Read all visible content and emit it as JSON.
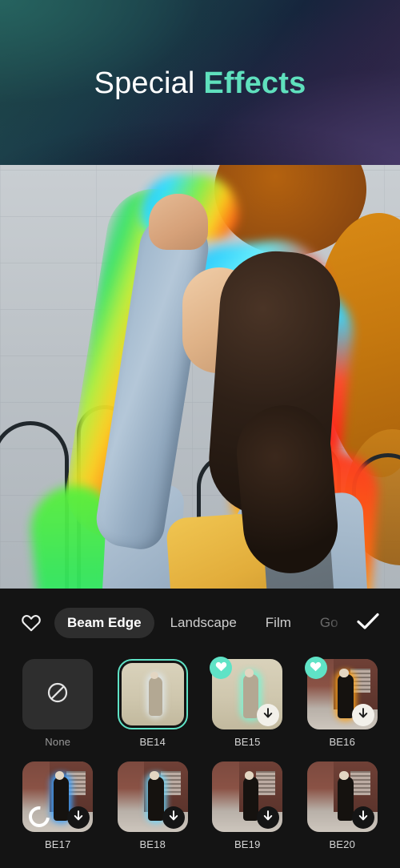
{
  "header": {
    "title_plain": "Special",
    "title_accent": "Effects",
    "gradient_start": "#23504f",
    "gradient_end": "#3a3355"
  },
  "preview": {
    "effect_applied": "BE14",
    "description": "Woman dancing in denim jacket with rainbow beam edge outline"
  },
  "toolbar": {
    "favorites_icon": "heart-outline-icon",
    "confirm_icon": "check-icon",
    "accent_color": "#5fe3c6",
    "tabs": [
      {
        "label": "Beam Edge",
        "active": true,
        "faded": false
      },
      {
        "label": "Landscape",
        "active": false,
        "faded": false
      },
      {
        "label": "Film",
        "active": false,
        "faded": false
      },
      {
        "label": "Go",
        "active": false,
        "faded": true
      }
    ]
  },
  "effects": {
    "items": [
      {
        "label": "None",
        "icon": "no-effect-icon",
        "kind": "none",
        "selected": false,
        "favorite": false,
        "download": "none",
        "loading": false,
        "scene": "none",
        "glow": "none"
      },
      {
        "label": "BE14",
        "kind": "effect",
        "selected": true,
        "favorite": false,
        "download": "none",
        "loading": false,
        "scene": "warm",
        "glow": "pale"
      },
      {
        "label": "BE15",
        "kind": "effect",
        "selected": false,
        "favorite": true,
        "download": "light",
        "loading": false,
        "scene": "warm",
        "glow": "mint"
      },
      {
        "label": "BE16",
        "kind": "effect",
        "selected": false,
        "favorite": true,
        "download": "light",
        "loading": false,
        "scene": "brick",
        "glow": "amber"
      },
      {
        "label": "BE17",
        "kind": "effect",
        "selected": false,
        "favorite": false,
        "download": "dark",
        "loading": true,
        "scene": "brick",
        "glow": "blue"
      },
      {
        "label": "BE18",
        "kind": "effect",
        "selected": false,
        "favorite": false,
        "download": "dark",
        "loading": false,
        "scene": "brick",
        "glow": "cyan"
      },
      {
        "label": "BE19",
        "kind": "effect",
        "selected": false,
        "favorite": false,
        "download": "dark",
        "loading": false,
        "scene": "brick",
        "glow": "none"
      },
      {
        "label": "BE20",
        "kind": "effect",
        "selected": false,
        "favorite": false,
        "download": "dark",
        "loading": false,
        "scene": "brick",
        "glow": "none"
      }
    ]
  }
}
